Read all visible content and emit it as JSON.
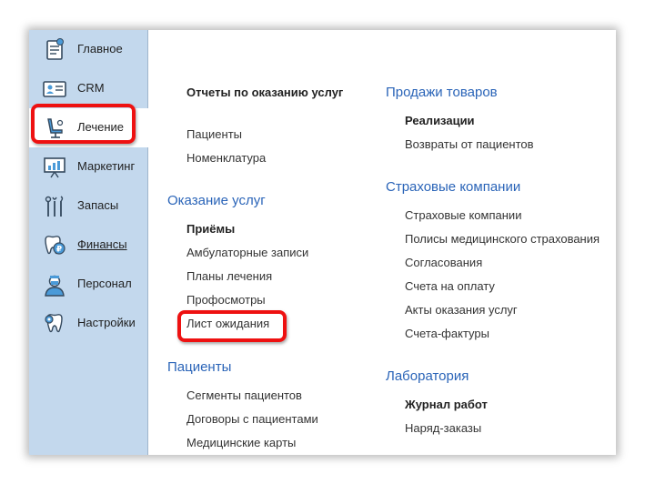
{
  "sidebar": {
    "items": [
      {
        "label": "Главное",
        "icon": "home-list-icon"
      },
      {
        "label": "CRM",
        "icon": "id-card-icon"
      },
      {
        "label": "Лечение",
        "icon": "dental-chair-icon"
      },
      {
        "label": "Маркетинг",
        "icon": "presentation-chart-icon"
      },
      {
        "label": "Запасы",
        "icon": "dental-tools-icon"
      },
      {
        "label": "Финансы",
        "icon": "tooth-coin-icon"
      },
      {
        "label": "Персонал",
        "icon": "doctor-icon"
      },
      {
        "label": "Настройки",
        "icon": "tooth-gear-icon"
      }
    ]
  },
  "content": {
    "col1": {
      "reports_header": "Отчеты по оказанию услуг",
      "reports_items": [
        "Пациенты",
        "Номенклатура"
      ],
      "services_title": "Оказание услуг",
      "services_bold": "Приёмы",
      "services_items": [
        "Амбулаторные записи",
        "Планы лечения",
        "Профосмотры",
        "Лист ожидания"
      ],
      "patients_title": "Пациенты",
      "patients_items": [
        "Сегменты пациентов",
        "Договоры с пациентами",
        "Медицинские карты"
      ]
    },
    "col2": {
      "sales_title": "Продажи товаров",
      "sales_bold": "Реализации",
      "sales_items": [
        "Возвраты от пациентов"
      ],
      "insurance_title": "Страховые компании",
      "insurance_items": [
        "Страховые компании",
        "Полисы медицинского страхования",
        "Согласования",
        "Счета на оплату",
        "Акты оказания услуг",
        "Счета-фактуры"
      ],
      "lab_title": "Лаборатория",
      "lab_bold": "Журнал работ",
      "lab_items": [
        "Наряд-заказы"
      ]
    }
  },
  "colors": {
    "sidebar_bg": "#c3d8ed",
    "section_title": "#2a64b8",
    "highlight": "#ee1111"
  }
}
